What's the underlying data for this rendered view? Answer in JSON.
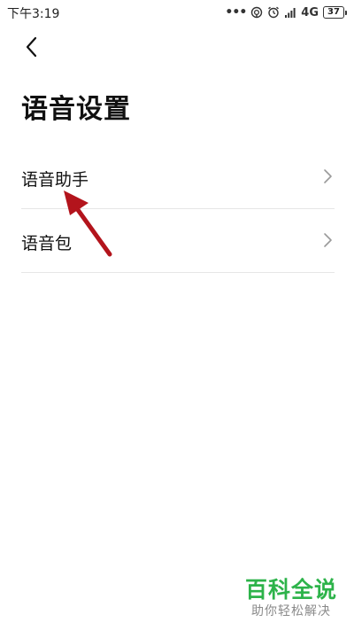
{
  "status_bar": {
    "time": "下午3:19",
    "network": "4G",
    "battery": "37",
    "icons": [
      "more-dots-icon",
      "hotspot-icon",
      "alarm-icon",
      "signal-icon",
      "battery-icon"
    ]
  },
  "header": {
    "back_icon": "chevron-left-icon",
    "title": "语音设置"
  },
  "menu": {
    "items": [
      {
        "label": "语音助手",
        "icon": "chevron-right-icon"
      },
      {
        "label": "语音包",
        "icon": "chevron-right-icon"
      }
    ]
  },
  "annotation": {
    "color": "#b3141c"
  },
  "watermark": {
    "title": "百科全说",
    "subtitle": "助你轻松解决",
    "title_color": "#2db34a",
    "subtitle_color": "#8a8a8a"
  }
}
